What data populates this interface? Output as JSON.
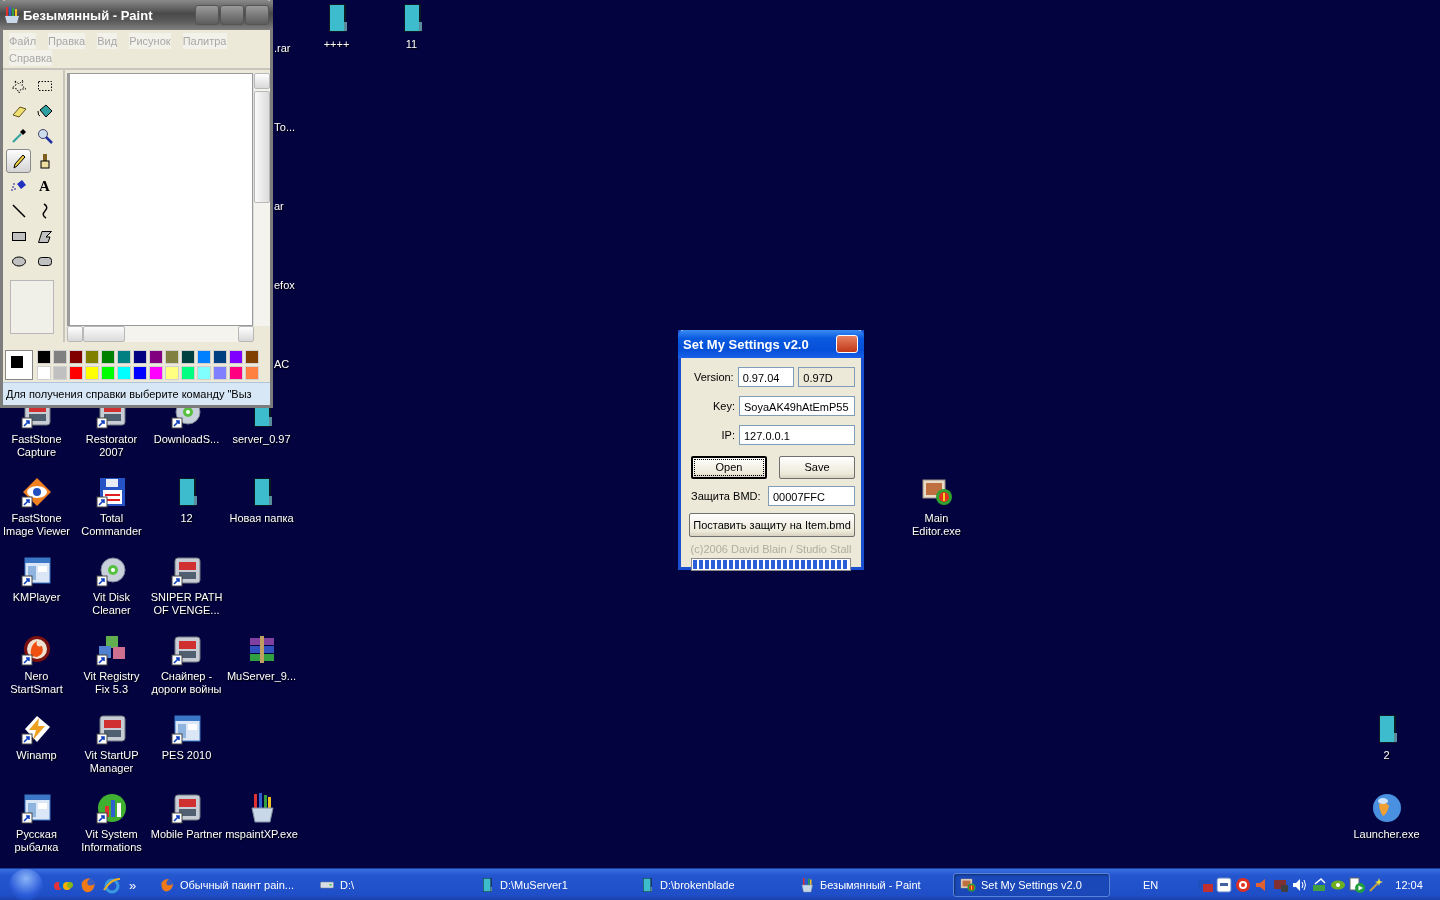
{
  "desktop": {
    "icons": [
      {
        "label": ".rar",
        "kind": "clipped"
      },
      {
        "label": "++++",
        "kind": "book",
        "shortcut": false
      },
      {
        "label": "11",
        "kind": "book",
        "shortcut": false
      },
      {
        "label": "То...",
        "kind": "clipped"
      },
      {
        "label": "ar",
        "kind": "clipped"
      },
      {
        "label": "efox",
        "kind": "clipped"
      },
      {
        "label": "AC",
        "kind": "clipped"
      },
      {
        "label": "FastStone\nCapture",
        "kind": "app",
        "shortcut": true
      },
      {
        "label": "Restorator\n2007",
        "kind": "app",
        "shortcut": true
      },
      {
        "label": "DownloadS...",
        "kind": "disc",
        "shortcut": true
      },
      {
        "label": "server_0.97",
        "kind": "book",
        "shortcut": false
      },
      {
        "label": "FastStone\nImage Viewer",
        "kind": "eye",
        "shortcut": true
      },
      {
        "label": "Total\nCommander",
        "kind": "floppy",
        "shortcut": true
      },
      {
        "label": "12",
        "kind": "book",
        "shortcut": false
      },
      {
        "label": "Новая папка",
        "kind": "book",
        "shortcut": false
      },
      {
        "label": "Main\nEditor.exe",
        "kind": "monitor",
        "shortcut": false
      },
      {
        "label": "KMPlayer",
        "kind": "window",
        "shortcut": true
      },
      {
        "label": "Vit Disk\nCleaner",
        "kind": "disc",
        "shortcut": true
      },
      {
        "label": "SNIPER PATH\nOF VENGE...",
        "kind": "app",
        "shortcut": true
      },
      {
        "label": "Nero\nStartSmart",
        "kind": "flame",
        "shortcut": true
      },
      {
        "label": "Vit Registry\nFix 5.3",
        "kind": "cubes",
        "shortcut": true
      },
      {
        "label": "Снайпер -\nдороги войны",
        "kind": "app",
        "shortcut": true
      },
      {
        "label": "MuServer_9...",
        "kind": "books",
        "shortcut": false
      },
      {
        "label": "Winamp",
        "kind": "bolt",
        "shortcut": true
      },
      {
        "label": "Vit StartUP\nManager",
        "kind": "app",
        "shortcut": true
      },
      {
        "label": "PES 2010",
        "kind": "window",
        "shortcut": true
      },
      {
        "label": "2",
        "kind": "book",
        "shortcut": false
      },
      {
        "label": "Русская\nрыбалка",
        "kind": "window",
        "shortcut": true
      },
      {
        "label": "Vit System\nInformations",
        "kind": "chart",
        "shortcut": true
      },
      {
        "label": "Mobile Partner",
        "kind": "app",
        "shortcut": true
      },
      {
        "label": "mspaintXP.exe",
        "kind": "brushes",
        "shortcut": false
      },
      {
        "label": "Launcher.exe",
        "kind": "globe",
        "shortcut": false
      }
    ]
  },
  "paint": {
    "title": "Безымянный - Paint",
    "menu": [
      {
        "label": "Файл"
      },
      {
        "label": "Правка"
      },
      {
        "label": "Вид"
      },
      {
        "label": "Рисунок"
      },
      {
        "label": "Палитра"
      },
      {
        "label": "Справка"
      }
    ],
    "tools": [
      {
        "kind": "free-select",
        "selected": false
      },
      {
        "kind": "rect-select",
        "selected": false
      },
      {
        "kind": "eraser",
        "selected": false
      },
      {
        "kind": "fill",
        "selected": false
      },
      {
        "kind": "picker",
        "selected": false
      },
      {
        "kind": "magnifier",
        "selected": false
      },
      {
        "kind": "pencil",
        "selected": true
      },
      {
        "kind": "brush",
        "selected": false
      },
      {
        "kind": "airbrush",
        "selected": false
      },
      {
        "kind": "text",
        "glyph": "A",
        "selected": false
      },
      {
        "kind": "line",
        "selected": false
      },
      {
        "kind": "curve",
        "selected": false
      },
      {
        "kind": "rectangle",
        "selected": false
      },
      {
        "kind": "polygon",
        "selected": false
      },
      {
        "kind": "ellipse",
        "selected": false
      },
      {
        "kind": "rounded",
        "selected": false
      }
    ],
    "palette": [
      {
        "color": "#000000"
      },
      {
        "color": "#808080"
      },
      {
        "color": "#800000"
      },
      {
        "color": "#808000"
      },
      {
        "color": "#008000"
      },
      {
        "color": "#008080"
      },
      {
        "color": "#000080"
      },
      {
        "color": "#800080"
      },
      {
        "color": "#808040"
      },
      {
        "color": "#004040"
      },
      {
        "color": "#0080ff"
      },
      {
        "color": "#004080"
      },
      {
        "color": "#8000ff"
      },
      {
        "color": "#804000"
      },
      {
        "color": "#ffffff"
      },
      {
        "color": "#c0c0c0"
      },
      {
        "color": "#ff0000"
      },
      {
        "color": "#ffff00"
      },
      {
        "color": "#00ff00"
      },
      {
        "color": "#00ffff"
      },
      {
        "color": "#0000ff"
      },
      {
        "color": "#ff00ff"
      },
      {
        "color": "#ffff80"
      },
      {
        "color": "#00ff80"
      },
      {
        "color": "#80ffff"
      },
      {
        "color": "#8080ff"
      },
      {
        "color": "#ff0080"
      },
      {
        "color": "#ff8040"
      }
    ],
    "status": "Для получения справки выберите команду \"Выз"
  },
  "dialog": {
    "title": "Set My Settings v2.0",
    "version_label": "Version:",
    "version": "0.97.04",
    "version_code": "0.97D",
    "key_label": "Key:",
    "key": "SoyaAK49hAtEmP55",
    "ip_label": "IP:",
    "ip": "127.0.0.1",
    "buttons": [
      {
        "label": "Open",
        "focused": true
      },
      {
        "label": "Save",
        "focused": false
      }
    ],
    "bmd_label": "Защита BMD:",
    "bmd": "00007FFC",
    "protect_button": "Поставить защиту на Item.bmd",
    "footer": "(c)2006 David Blain / Studio Stall",
    "progress": {
      "level": 1
    }
  },
  "taskbar": {
    "more": "»",
    "tasks": [
      {
        "label": "Обычный паинт pain...",
        "kind": "browser",
        "selected": false
      },
      {
        "label": "D:\\",
        "kind": "drive",
        "selected": false
      },
      {
        "label": "D:\\MuServer1",
        "kind": "book",
        "selected": false
      },
      {
        "label": "D:\\brokenblade",
        "kind": "book",
        "selected": false
      },
      {
        "label": "Безымянный - Paint",
        "kind": "brushes",
        "selected": false
      },
      {
        "label": "Set My Settings v2.0",
        "kind": "monitor",
        "selected": true
      }
    ],
    "language": "EN",
    "clock": "12:04"
  }
}
